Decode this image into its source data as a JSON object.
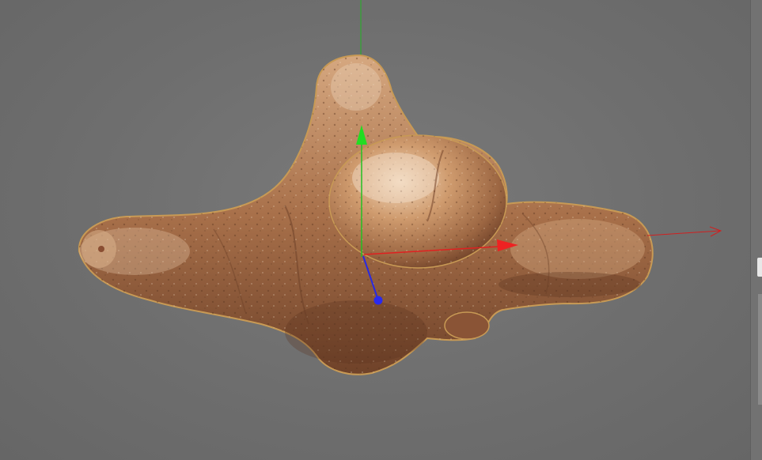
{
  "viewport": {
    "colors": {
      "background": "#6f6f6f",
      "x_axis": "#e02020",
      "y_axis": "#20c020",
      "z_axis": "#2a2ae0",
      "object_outline": "#c89a55",
      "object_base": "#a86e45"
    },
    "gizmo": {
      "x_icon": "x-axis-arrow-icon",
      "y_icon": "y-axis-arrow-icon",
      "z_icon": "z-axis-handle-icon"
    },
    "object": {
      "icon": "selected-3d-mesh"
    }
  },
  "side_panel": {
    "tab_icon": "panel-tab-icon"
  }
}
